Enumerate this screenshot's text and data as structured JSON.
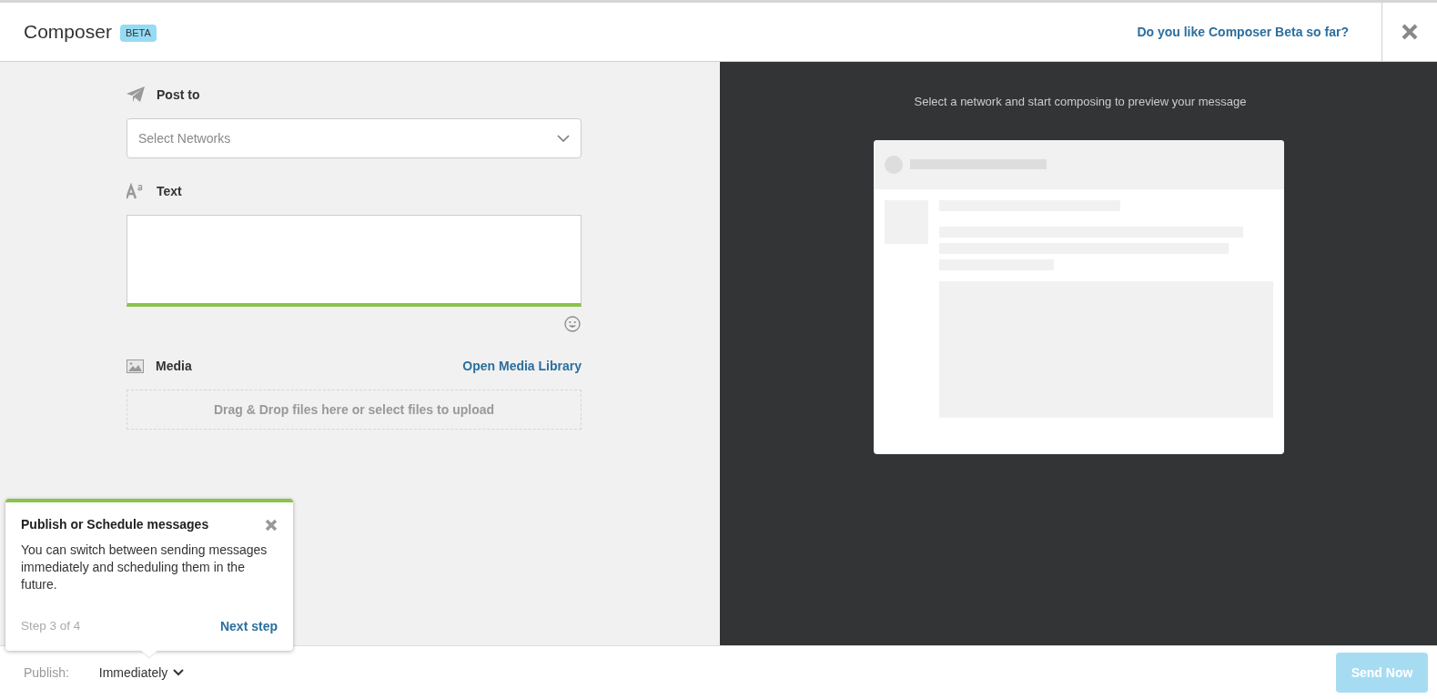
{
  "header": {
    "title": "Composer",
    "badge": "BETA",
    "feedback_link": "Do you like Composer Beta so far?"
  },
  "form": {
    "post_to": {
      "label": "Post to",
      "placeholder": "Select Networks"
    },
    "text": {
      "label": "Text"
    },
    "media": {
      "label": "Media",
      "link": "Open Media Library",
      "dropzone": "Drag & Drop files here or select files to upload"
    }
  },
  "preview": {
    "hint": "Select a network and start composing to preview your message"
  },
  "tooltip": {
    "title": "Publish or Schedule messages",
    "body": "You can switch between sending messages immediately and scheduling them in the future.",
    "step": "Step 3 of 4",
    "next": "Next step"
  },
  "footer": {
    "publish_label": "Publish:",
    "publish_value": "Immediately",
    "send_button": {
      "label": "Send Now",
      "disabled": true
    }
  }
}
